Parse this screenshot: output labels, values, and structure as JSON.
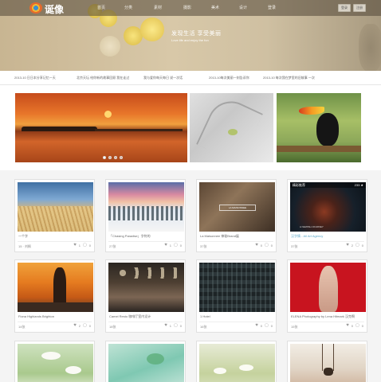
{
  "header": {
    "logo_text": "诞像",
    "nav": [
      "首页",
      "分类",
      "素材",
      "摄影",
      "美术",
      "设计",
      "登录"
    ],
    "buttons": [
      "登录",
      "注册"
    ],
    "slogan": "发现生活  享受美丽",
    "slogan_sub": "Love life and enjoy the fun"
  },
  "ticker": [
    "2013-10 日日本分享记忆一天",
    "北京天坛  给你新的故事回顾  我在走过",
    "我与爱你每天每日  说一次话",
    "2013-10每次美丽一刻告诉你",
    "2013-10 每次我在梦里的旧故事  一次"
  ],
  "carousel": {
    "dots": 4,
    "active_dot": 0
  },
  "cards": [
    {
      "title": "一个字",
      "author": "15 · 刘枫",
      "likes": "1",
      "comments": "0"
    },
    {
      "title": "「Chasing Paradise」字符的",
      "author": "27张",
      "likes": "1",
      "comments": "0"
    },
    {
      "title": "La Maisonnee 神秘Brand展",
      "author": "37张",
      "likes": "0",
      "comments": "0",
      "overlay_mid": "LA MAISONNEE"
    },
    {
      "title": "汉字情 - All Art Agency",
      "author": "37张",
      "likes": "2",
      "comments": "0",
      "title_blue": true,
      "overlay_left": "精彩推荐",
      "overlay_right": "233 ★",
      "overlay_bottom": "A NEWISH JOURNEY"
    },
    {
      "title": "Fiona Highlands Brighton",
      "author": "14张",
      "likes": "2",
      "comments": "0"
    },
    {
      "title": "Camel Resto 咖啡厅室内设计",
      "author": "18张",
      "likes": "1",
      "comments": "0"
    },
    {
      "title": "1 Hotel",
      "author": "16张",
      "likes": "0",
      "comments": "0"
    },
    {
      "title": "ELENA Photography by Lena Hitmark 汉克啊",
      "author": "15张",
      "likes": "0",
      "comments": "0"
    },
    {
      "title": "",
      "author": "",
      "likes": "",
      "comments": ""
    },
    {
      "title": "",
      "author": "",
      "likes": "",
      "comments": ""
    },
    {
      "title": "",
      "author": "",
      "likes": "",
      "comments": ""
    },
    {
      "title": "",
      "author": "",
      "likes": "",
      "comments": ""
    }
  ],
  "icons": {
    "like": "heart-icon",
    "comment": "comment-icon",
    "logo": "camera-lens-icon"
  },
  "colors": {
    "nav_bg": "#50463780",
    "accent_blue": "#5aa7c9"
  }
}
